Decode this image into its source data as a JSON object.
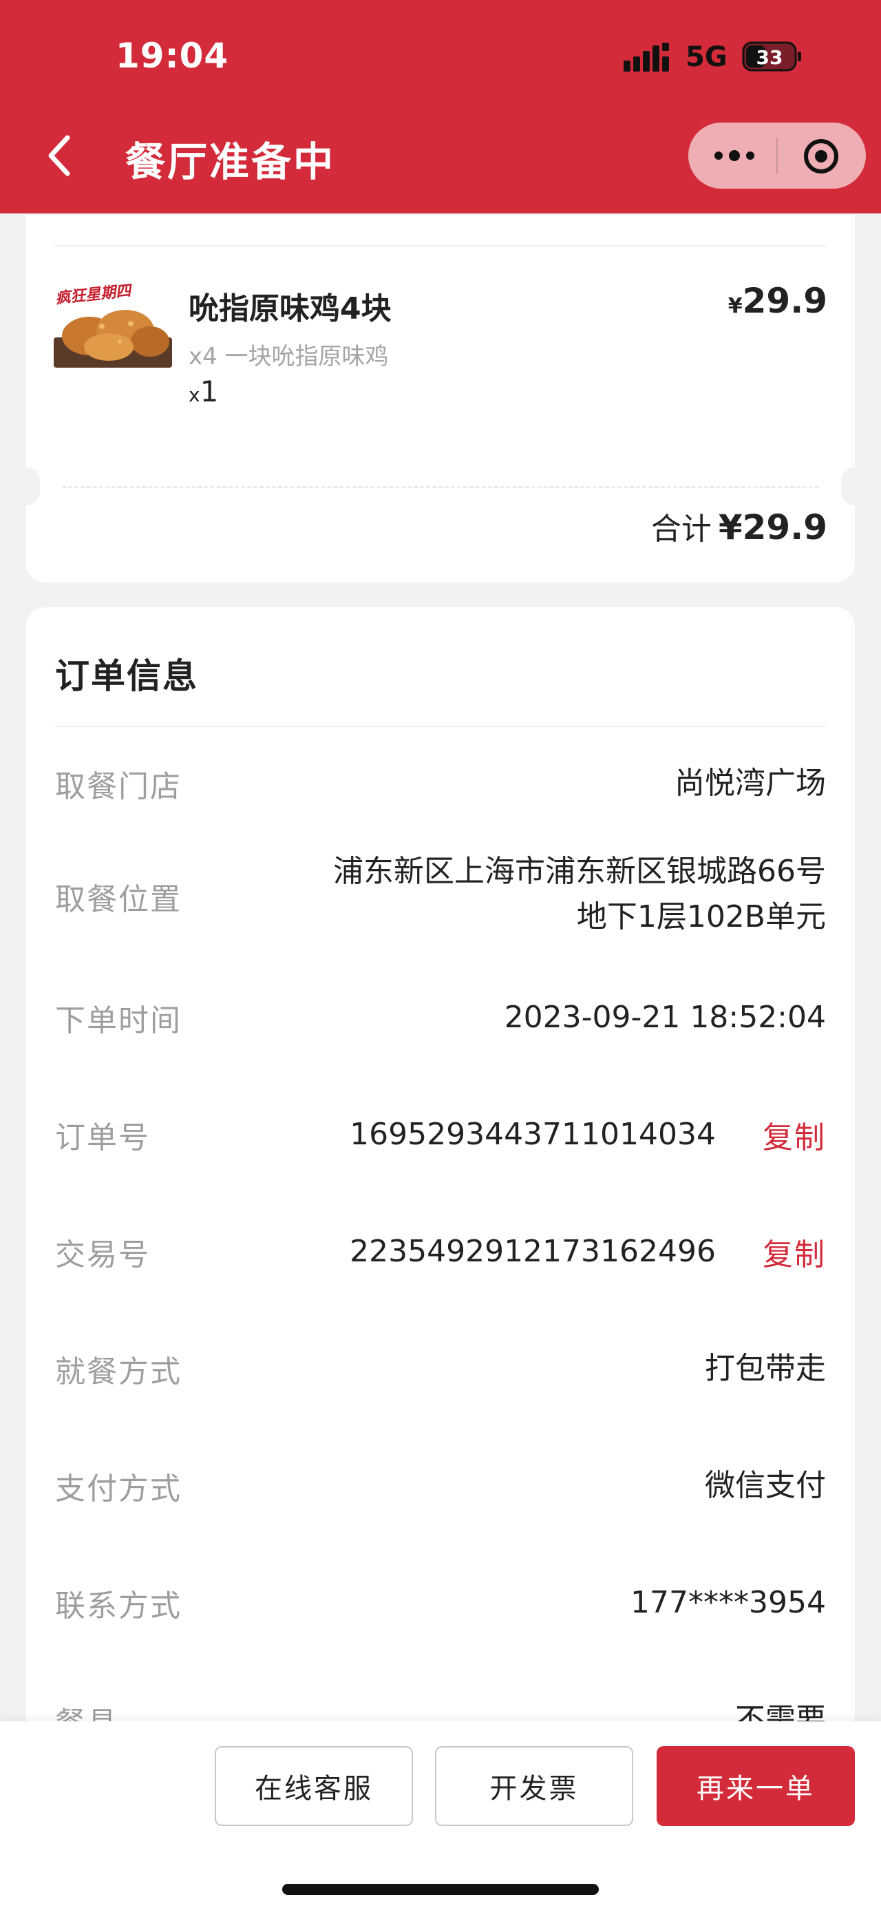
{
  "status_bar": {
    "time": "19:04",
    "network": "5G",
    "battery": "33"
  },
  "header": {
    "title": "餐厅准备中"
  },
  "order_item": {
    "name": "吮指原味鸡4块",
    "price_currency": "¥",
    "price_value": "29.9",
    "description": "x4 一块吮指原味鸡",
    "qty_prefix": "x",
    "qty_value": "1",
    "image_caption": "疯狂星期四"
  },
  "summary": {
    "total_label": "合计",
    "total_amount": "¥29.9"
  },
  "order_info": {
    "title": "订单信息",
    "store_label": "取餐门店",
    "store_value": "尚悦湾广场",
    "location_label": "取餐位置",
    "location_line1": "浦东新区上海市浦东新区银城路66号",
    "location_line2": "地下1层102B单元",
    "time_label": "下单时间",
    "time_value": "2023-09-21 18:52:04",
    "order_no_label": "订单号",
    "order_no_value": "1695293443711014034",
    "trade_no_label": "交易号",
    "trade_no_value": "2235492912173162496",
    "copy_label": "复制",
    "dining_label": "就餐方式",
    "dining_value": "打包带走",
    "payment_label": "支付方式",
    "payment_value": "微信支付",
    "contact_label": "联系方式",
    "contact_value": "177****3954",
    "cutlery_label": "餐具",
    "cutlery_value": "不需要"
  },
  "actions": {
    "service": "在线客服",
    "invoice": "开发票",
    "reorder": "再来一单"
  },
  "colors": {
    "brand_red": "#d32b39",
    "background": "#f2f2f2",
    "label_gray": "#9e9e9e"
  }
}
